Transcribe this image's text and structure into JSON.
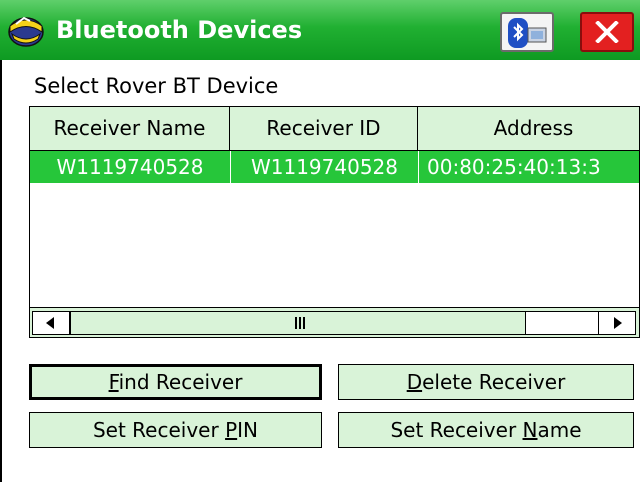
{
  "window": {
    "title": "Bluetooth Devices"
  },
  "subtitle": "Select Rover BT Device",
  "table": {
    "columns": [
      "Receiver Name",
      "Receiver ID",
      "Address"
    ],
    "rows": [
      [
        "W1119740528",
        "W1119740528",
        "00:80:25:40:13:3"
      ]
    ]
  },
  "scrollbar": {
    "grip_glyph": "III"
  },
  "buttons": {
    "find": {
      "pre": "",
      "mnemonic": "F",
      "post": "ind Receiver"
    },
    "delete": {
      "pre": "",
      "mnemonic": "D",
      "post": "elete Receiver"
    },
    "set_pin": {
      "pre": "Set Receiver ",
      "mnemonic": "P",
      "post": "IN"
    },
    "set_name": {
      "pre": "Set Receiver ",
      "mnemonic": "N",
      "post": "ame"
    }
  },
  "colors": {
    "titlebar": "#21b032",
    "selection": "#26c63a",
    "control_face": "#d9f3d8",
    "close": "#e32020"
  },
  "icons": {
    "app": "trimble-globe-icon",
    "bluetooth": "bluetooth-icon",
    "close": "close-icon"
  }
}
